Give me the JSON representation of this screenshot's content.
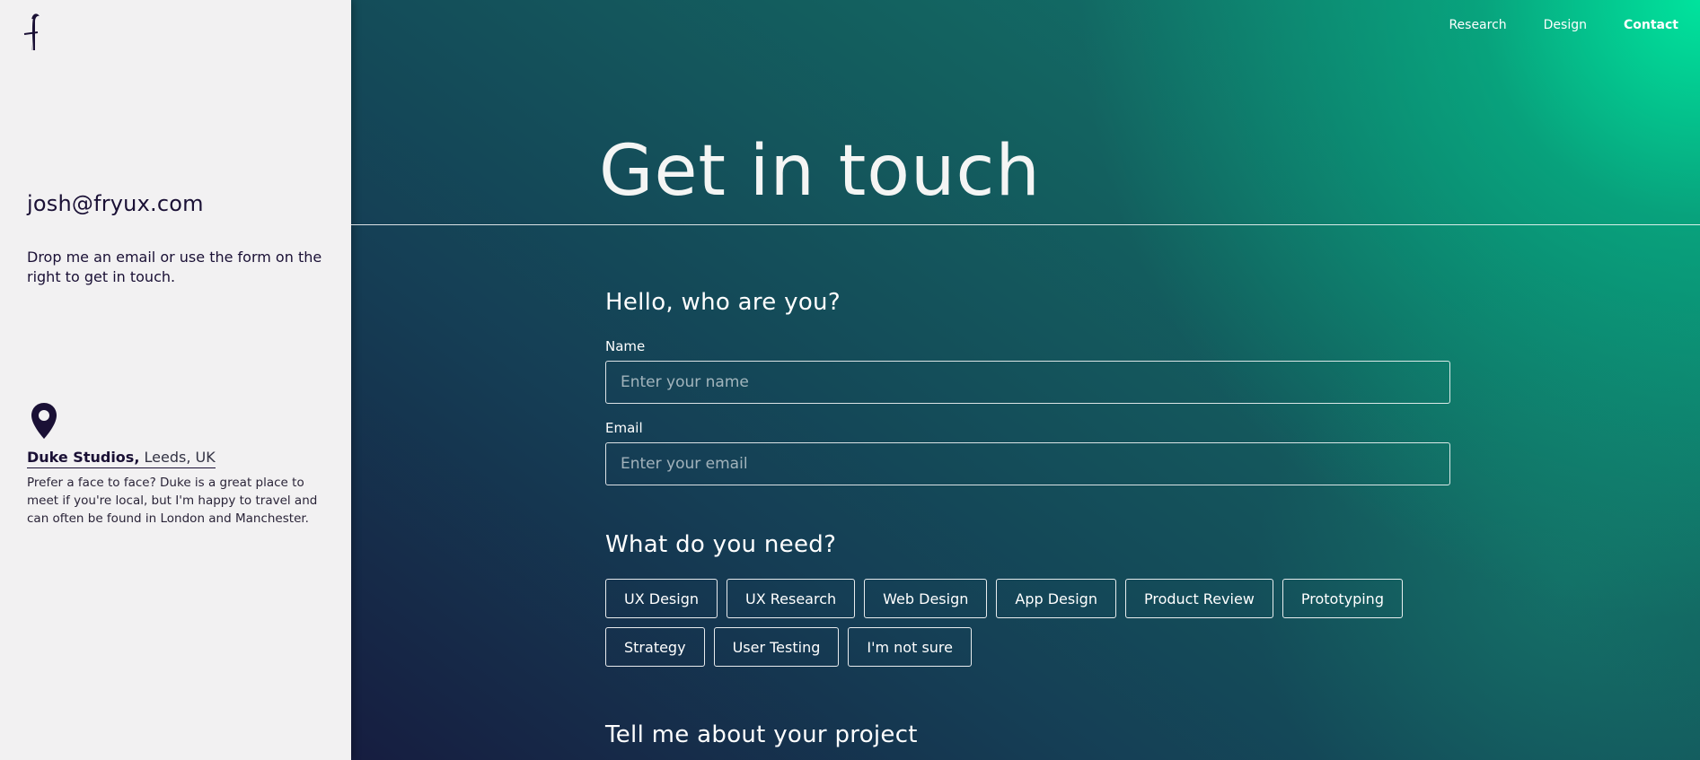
{
  "sidebar": {
    "logo_icon": "script-f-logo",
    "email": "josh@fryux.com",
    "blurb": "Drop me an email or use the form on the right to get in touch.",
    "location_icon": "map-pin-icon",
    "location_studio": "Duke Studios,",
    "location_city": "Leeds, UK",
    "location_text": "Prefer a face to face? Duke is a great place to meet if you're local, but I'm happy to travel and can often be found in London and Manchester."
  },
  "nav": {
    "items": [
      {
        "label": "Research"
      },
      {
        "label": "Design"
      },
      {
        "label": "Contact",
        "active": true
      }
    ]
  },
  "main": {
    "title": "Get in touch",
    "who_heading": "Hello, who are you?",
    "name_label": "Name",
    "name_placeholder": "Enter your name",
    "name_value": "",
    "email_label": "Email",
    "email_placeholder": "Enter your email",
    "email_value": "",
    "need_heading": "What do you need?",
    "services_row1": [
      "UX Design",
      "UX Research",
      "Web Design",
      "App Design",
      "Product Review",
      "Prototyping"
    ],
    "services_row2": [
      "Strategy",
      "User Testing",
      "I'm not sure"
    ],
    "project_heading": "Tell me about your project"
  },
  "colors": {
    "sidebar_bg": "#f2f1f2",
    "ink": "#1a1035",
    "gradient_dark": "#161d40",
    "gradient_teal": "#13605f",
    "accent_green": "#00e39d"
  }
}
